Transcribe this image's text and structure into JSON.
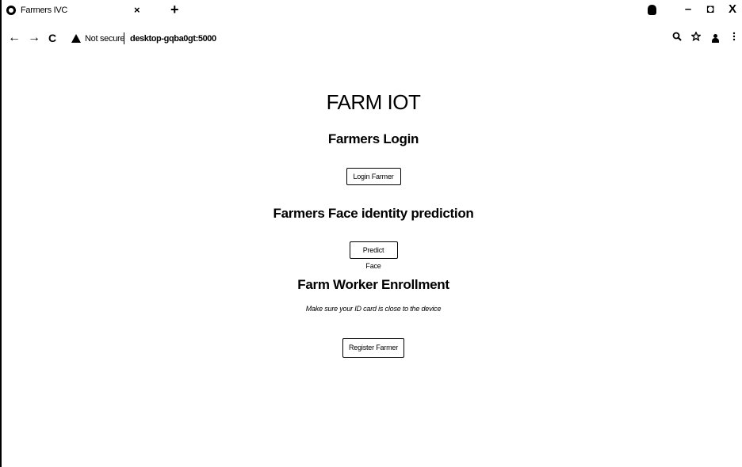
{
  "browser": {
    "tab_title": "Farmers IVC",
    "tab_close": "×",
    "new_tab": "+",
    "window_controls": {
      "minimize": "–",
      "maximize": "◘",
      "close": "X"
    },
    "nav": {
      "back": "←",
      "forward": "→",
      "reload": "C"
    },
    "security_label": "Not secure",
    "url": "desktop-gqba0gt:5000",
    "icons": [
      "favicon-icon",
      "profile-icon",
      "warning-icon",
      "zoom-icon",
      "star-icon",
      "person-icon",
      "menu-icon"
    ]
  },
  "page": {
    "title": "FARM IOT",
    "login_heading": "Farmers Login",
    "login_button": "Login Farmer",
    "predict_heading": "Farmers Face identity prediction",
    "predict_button": "Predict Face",
    "enroll_heading": "Farm Worker Enrollment",
    "enroll_note": "Make sure your ID card is close to the device",
    "register_button": "Register Farmer"
  }
}
